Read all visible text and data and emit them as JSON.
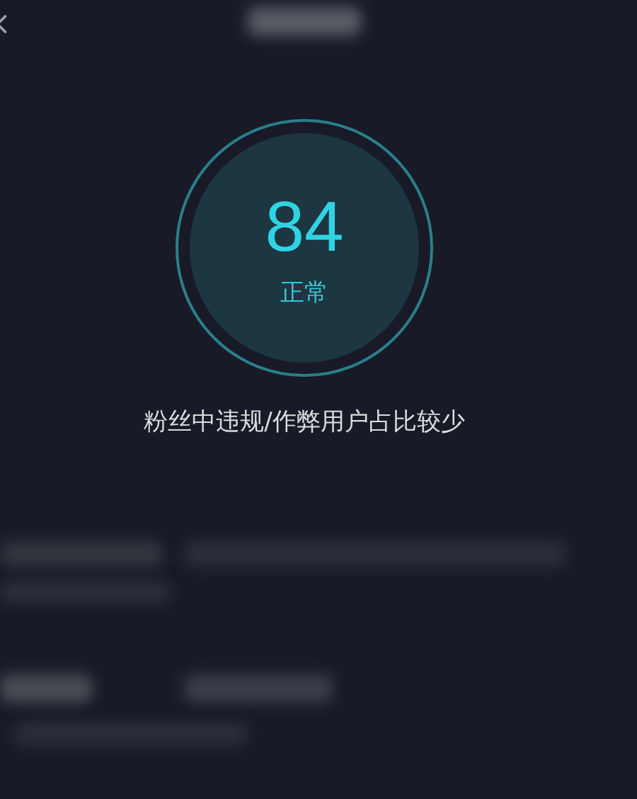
{
  "score": {
    "value": "84",
    "status": "正常"
  },
  "description": "粉丝中违规/作弊用户占比较少"
}
